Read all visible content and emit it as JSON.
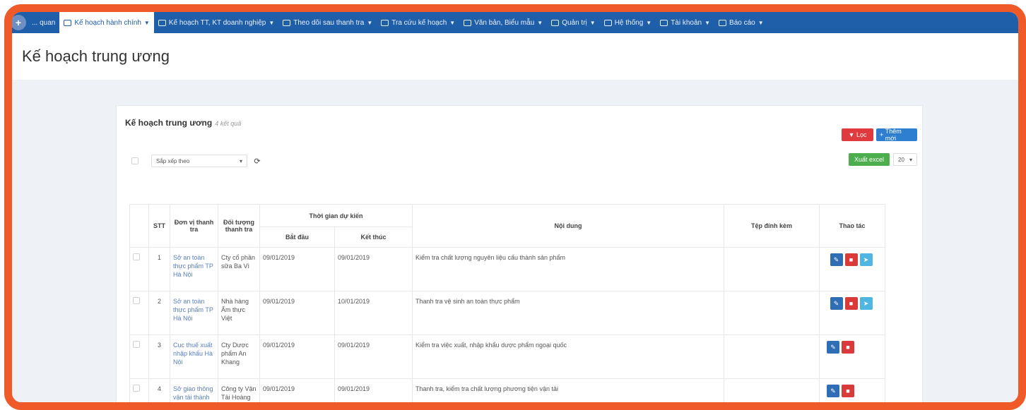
{
  "nav": {
    "home_label": "... quan",
    "items": [
      {
        "label": "Kế hoạch hành chính"
      },
      {
        "label": "Kế hoạch TT, KT doanh nghiệp"
      },
      {
        "label": "Theo dõi sau thanh tra"
      },
      {
        "label": "Tra cứu kế hoạch"
      },
      {
        "label": "Văn bản, Biểu mẫu"
      },
      {
        "label": "Quản trị"
      },
      {
        "label": "Hệ thống"
      },
      {
        "label": "Tài khoản"
      },
      {
        "label": "Báo cáo"
      }
    ]
  },
  "page": {
    "title": "Kế hoạch trung ương"
  },
  "panel": {
    "title": "Kế hoạch trung ương",
    "count": "4 kết quả",
    "filter_label": "Lọc",
    "add_label": "Thêm mới",
    "export_label": "Xuất excel",
    "page_size": "20",
    "sort_label": "Sắp xếp theo"
  },
  "table": {
    "headers": {
      "stt": "STT",
      "unit": "Đơn vị thanh tra",
      "target": "Đối tượng thanh tra",
      "time_group": "Thời gian dự kiến",
      "start": "Bắt đầu",
      "end": "Kết thúc",
      "content": "Nội dung",
      "attach": "Tệp đính kèm",
      "action": "Thao tác"
    },
    "rows": [
      {
        "stt": "1",
        "unit": "Sở an toàn thực phẩm TP Hà Nội",
        "target": "Cty cổ phần sữa Ba Vì",
        "start": "09/01/2019",
        "end": "09/01/2019",
        "content": "Kiểm tra chất lượng nguyên liệu cấu thành sản phẩm"
      },
      {
        "stt": "2",
        "unit": "Sở an toàn thực phẩm TP Hà Nội",
        "target": "Nhà hàng Ẩm thực Việt",
        "start": "09/01/2019",
        "end": "10/01/2019",
        "content": "Thanh tra vệ sinh an toàn thực phẩm"
      },
      {
        "stt": "3",
        "unit": "Cục thuế xuất nhập khẩu Hà Nội",
        "target": "Cty Dược phẩm An Khang",
        "start": "09/01/2019",
        "end": "09/01/2019",
        "content": "Kiểm tra việc xuất, nhập khẩu dược phẩm ngoại quốc"
      },
      {
        "stt": "4",
        "unit": "Sở giao thông vận tải thành phố Hà Nội",
        "target": "Công ty Vận Tải Hoàng Hà",
        "start": "09/01/2019",
        "end": "09/01/2019",
        "content": "Thanh tra, kiểm tra chất lượng phương tiện vận tải"
      }
    ]
  },
  "colors": {
    "accent": "#1f5ea8",
    "frame": "#f05a28",
    "danger": "#e0393e",
    "success": "#4cae4c"
  },
  "icons": {
    "edit": "pencil-icon",
    "delete": "trash-icon",
    "send": "send-icon"
  }
}
